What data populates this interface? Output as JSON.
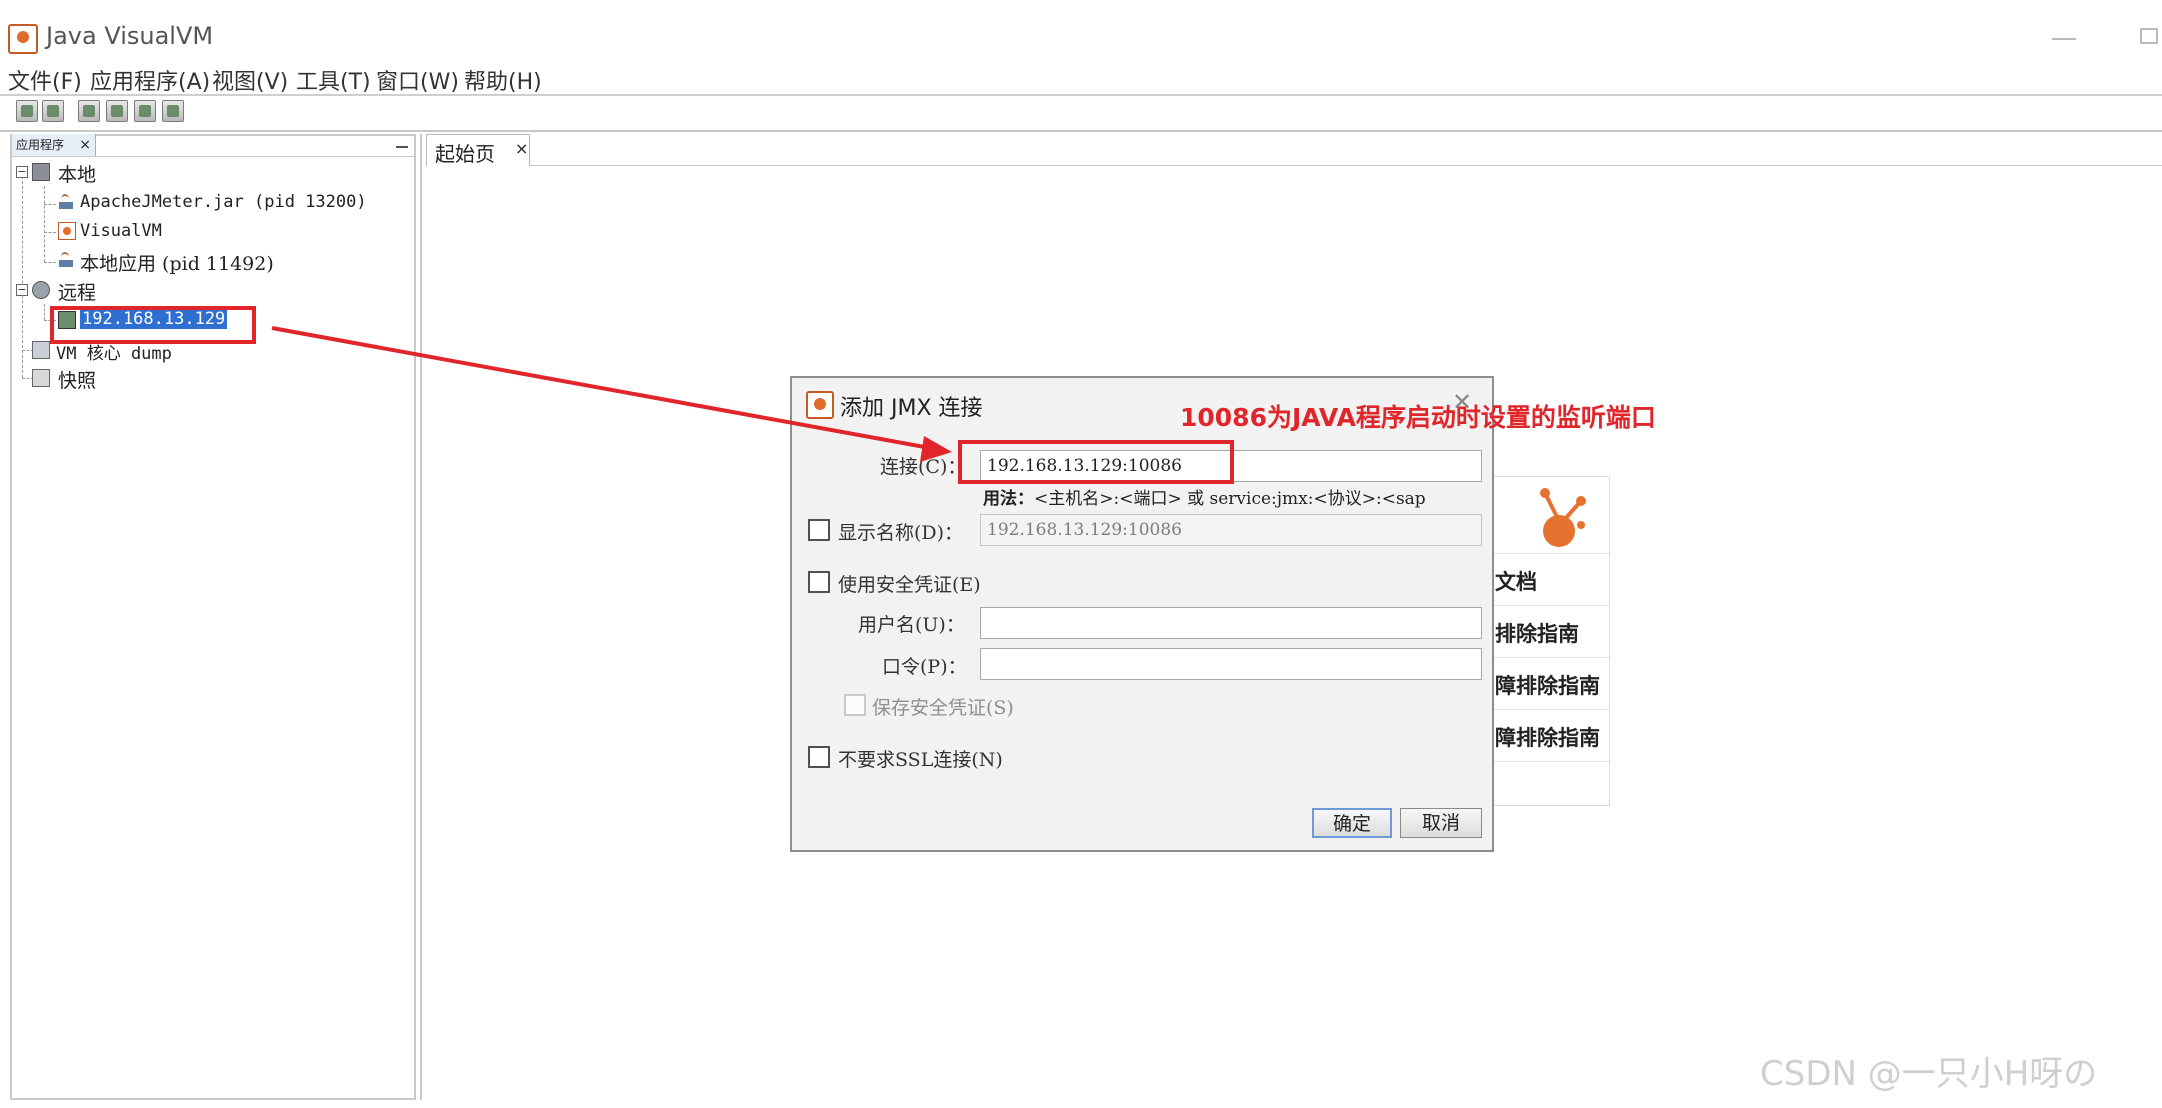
{
  "window": {
    "title": "Java VisualVM"
  },
  "menu": [
    {
      "label": "文件(F)"
    },
    {
      "label": "应用程序(A)"
    },
    {
      "label": "视图(V)"
    },
    {
      "label": "工具(T)"
    },
    {
      "label": "窗口(W)"
    },
    {
      "label": "帮助(H)"
    }
  ],
  "left_panel": {
    "tab_label": "应用程序",
    "tree": {
      "local": "本地",
      "local_children": [
        "ApacheJMeter.jar (pid 13200)",
        "VisualVM",
        "本地应用 (pid 11492)"
      ],
      "remote": "远程",
      "remote_host": "192.168.13.129",
      "core_dump": "VM 核心 dump",
      "snapshots": "快照"
    }
  },
  "main": {
    "tab_label": "起始页",
    "card_items": [
      "文档",
      "排除指南",
      "障排除指南",
      "障排除指南"
    ]
  },
  "dialog": {
    "title": "添加 JMX 连接",
    "connection_label": "连接(C)：",
    "connection_value": "192.168.13.129:10086",
    "usage_prefix": "用法：",
    "usage_text": "<主机名>:<端口> 或 service:jmx:<协议>:<sap",
    "display_name_label": "显示名称(D)：",
    "display_name_value": "192.168.13.129:10086",
    "security_label": "使用安全凭证(E)",
    "username_label": "用户名(U)：",
    "password_label": "口令(P)：",
    "save_credentials_label": "保存安全凭证(S)",
    "no_ssl_label": "不要求SSL连接(N)",
    "ok_label": "确定",
    "cancel_label": "取消"
  },
  "annotation": {
    "text": "10086为JAVA程序启动时设置的监听端口",
    "color": "#e0262a"
  },
  "watermark": "CSDN @一只小H呀の"
}
